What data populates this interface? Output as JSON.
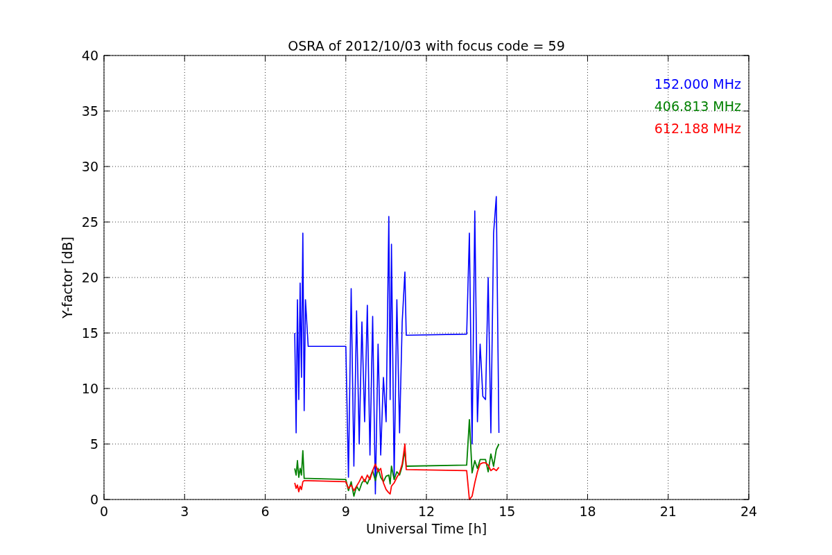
{
  "figure": {
    "chart_data": {
      "type": "line",
      "title": "OSRA of 2012/10/03 with focus code = 59",
      "xlabel": "Universal Time [h]",
      "ylabel": "Y-factor [dB]",
      "x": [
        7.1,
        7.15,
        7.2,
        7.25,
        7.3,
        7.35,
        7.4,
        7.45,
        7.5,
        7.6,
        9.0,
        9.1,
        9.2,
        9.3,
        9.4,
        9.5,
        9.6,
        9.7,
        9.8,
        9.9,
        10.0,
        10.1,
        10.2,
        10.3,
        10.4,
        10.5,
        10.6,
        10.65,
        10.7,
        10.8,
        10.9,
        11.0,
        11.1,
        11.2,
        11.25,
        13.5,
        13.6,
        13.7,
        13.8,
        13.9,
        14.0,
        14.1,
        14.2,
        14.3,
        14.4,
        14.5,
        14.6,
        14.7
      ],
      "series": [
        {
          "name": "152.000 MHz",
          "color": "#0000ff",
          "values": [
            15,
            6,
            18,
            9,
            19.5,
            11,
            24,
            8,
            18,
            13.8,
            13.8,
            2,
            19,
            3,
            17,
            5,
            16,
            7,
            17.5,
            4,
            16.5,
            0.5,
            14,
            4,
            11,
            7,
            25.5,
            9,
            23,
            2,
            18,
            6,
            16,
            20.5,
            14.8,
            14.9,
            24,
            5,
            26,
            7,
            14,
            9.3,
            9,
            20,
            6,
            24,
            27.3,
            6
          ]
        },
        {
          "name": "406.813 MHz",
          "color": "#008000",
          "values": [
            2.8,
            2.2,
            3.5,
            2,
            2.8,
            2.2,
            4.4,
            1.9,
            1.9,
            1.9,
            1.8,
            0.8,
            1.6,
            0.3,
            1.2,
            0.8,
            1.5,
            1.8,
            1.4,
            2,
            2.6,
            1.7,
            2.8,
            2,
            1.6,
            2.1,
            2.2,
            1.4,
            3,
            1.8,
            2.5,
            2.2,
            3,
            4.4,
            3,
            3.1,
            7.2,
            2.4,
            3.5,
            2.8,
            3.6,
            3.6,
            3.6,
            2.5,
            4.1,
            3,
            4.5,
            5
          ]
        },
        {
          "name": "612.188 MHz",
          "color": "#ff0000",
          "values": [
            1.5,
            1,
            1.3,
            0.7,
            1.2,
            0.9,
            1.6,
            1.7,
            1.7,
            1.7,
            1.6,
            1,
            1.3,
            0.8,
            1.2,
            1.6,
            2.1,
            1.6,
            2.2,
            1.8,
            2.6,
            3.2,
            2.5,
            2.8,
            1.5,
            0.9,
            0.6,
            0.5,
            1.2,
            1.5,
            2,
            2.4,
            3.2,
            5,
            2.7,
            2.6,
            0,
            0.3,
            1.5,
            2.5,
            3.2,
            3.3,
            3.3,
            3.1,
            2.6,
            2.8,
            2.6,
            2.9
          ]
        }
      ],
      "grid": true,
      "xlim": [
        0,
        24
      ],
      "ylim": [
        0,
        40
      ],
      "xticks": [
        0,
        3,
        6,
        9,
        12,
        15,
        18,
        21,
        24
      ],
      "yticks": [
        0,
        5,
        10,
        15,
        20,
        25,
        30,
        35,
        40
      ]
    }
  }
}
